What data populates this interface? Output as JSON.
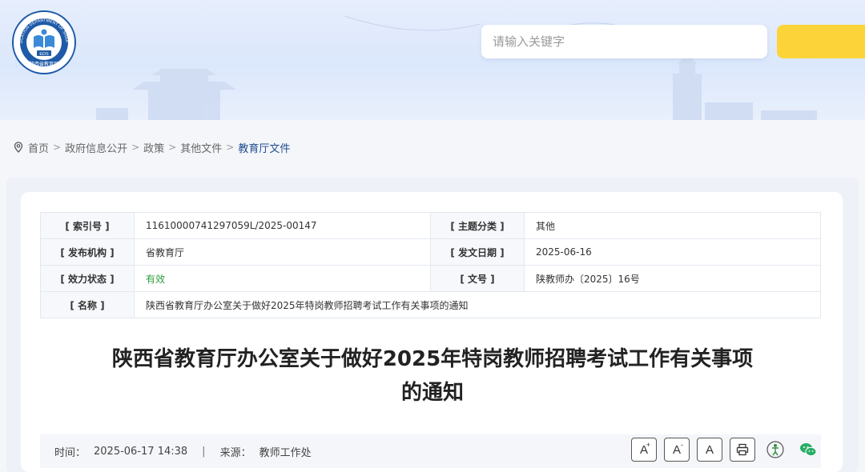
{
  "header": {
    "logo_text_top": "EDUCATION DEPARTMENT OF SHAANXI",
    "logo_text_center": "EDS",
    "logo_text_bottom": "陕西省教育厅",
    "search_placeholder": "请输入关键字"
  },
  "breadcrumb": {
    "items": [
      "首页",
      "政府信息公开",
      "政策",
      "其他文件",
      "教育厅文件"
    ],
    "separator": ">"
  },
  "info": {
    "index_label": "[ 索引号 ]",
    "index_value": "11610000741297059L/2025-00147",
    "topic_label": "[ 主题分类 ]",
    "topic_value": "其他",
    "publisher_label": "[ 发布机构 ]",
    "publisher_value": "省教育厅",
    "date_label": "[ 发文日期 ]",
    "date_value": "2025-06-16",
    "status_label": "[ 效力状态 ]",
    "status_value": "有效",
    "docno_label": "[ 文号 ]",
    "docno_value": "陕教师办〔2025〕16号",
    "name_label": "[ 名称 ]",
    "name_value": "陕西省教育厅办公室关于做好2025年特岗教师招聘考试工作有关事项的通知"
  },
  "title": {
    "line1": "陕西省教育厅办公室关于做好2025年特岗教师招聘考试工作有关事项",
    "line2": "的通知"
  },
  "meta": {
    "time_label": "时间：",
    "time_value": "2025-06-17 14:38",
    "divider": "|",
    "source_label": "来源：",
    "source_value": "教师工作处"
  },
  "tools": {
    "font_larger": "A",
    "font_larger_sup": "+",
    "font_smaller": "A",
    "font_smaller_sup": "-",
    "font_default": "A"
  },
  "colors": {
    "accent": "#1f4d8f",
    "search_button": "#fcd43a",
    "valid": "#2f9e3d",
    "wechat": "#2aae67"
  }
}
